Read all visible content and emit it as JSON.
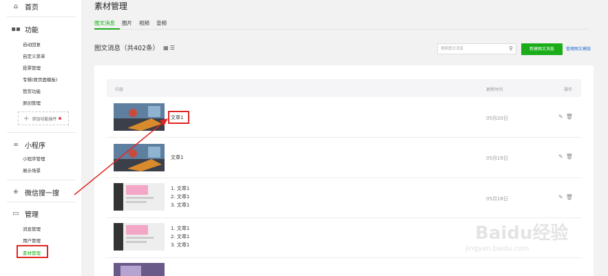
{
  "sidebar": {
    "home": "首页",
    "features": {
      "label": "功能",
      "items": [
        "自动回复",
        "自定义菜单",
        "投票管理",
        "专辑(原页面模板)",
        "赞赏功能",
        "原创管理"
      ],
      "add_plugin": "添加功能插件"
    },
    "miniprogram": {
      "label": "小程序",
      "items": [
        "小程序管理",
        "展示场景"
      ]
    },
    "search_label": "微信搜一搜",
    "manage": {
      "label": "管理",
      "items": [
        "消息管理",
        "用户管理",
        "素材管理"
      ]
    }
  },
  "header": {
    "title": "素材管理",
    "tabs": [
      "图文消息",
      "图片",
      "视频",
      "音频"
    ],
    "active_tab": "图文消息"
  },
  "toolbar": {
    "count_text": "图文消息（共402条）",
    "search_placeholder": "搜索图文消息",
    "new_button": "新建图文消息",
    "manage_link": "管理图文模版"
  },
  "table": {
    "columns": [
      "内容",
      "更新时间",
      "操作"
    ],
    "rows": [
      {
        "titles": [
          "文章1"
        ],
        "date": "05月20日",
        "thumb": "scene"
      },
      {
        "titles": [
          "文章1"
        ],
        "date": "05月19日",
        "thumb": "scene"
      },
      {
        "titles": [
          "1. 文章1",
          "2. 文章1",
          "3. 文章1"
        ],
        "date": "05月18日",
        "thumb": "page"
      },
      {
        "titles": [
          "1. 文章1",
          "2. 文章1",
          "3. 文章1"
        ],
        "date": "",
        "thumb": "page"
      }
    ]
  },
  "watermark": {
    "logo": "Baidu经验",
    "url": "jingyan.baidu.com"
  },
  "colors": {
    "accent": "#1aad19",
    "highlight": "#e0241f",
    "link": "#2b6ed1"
  }
}
